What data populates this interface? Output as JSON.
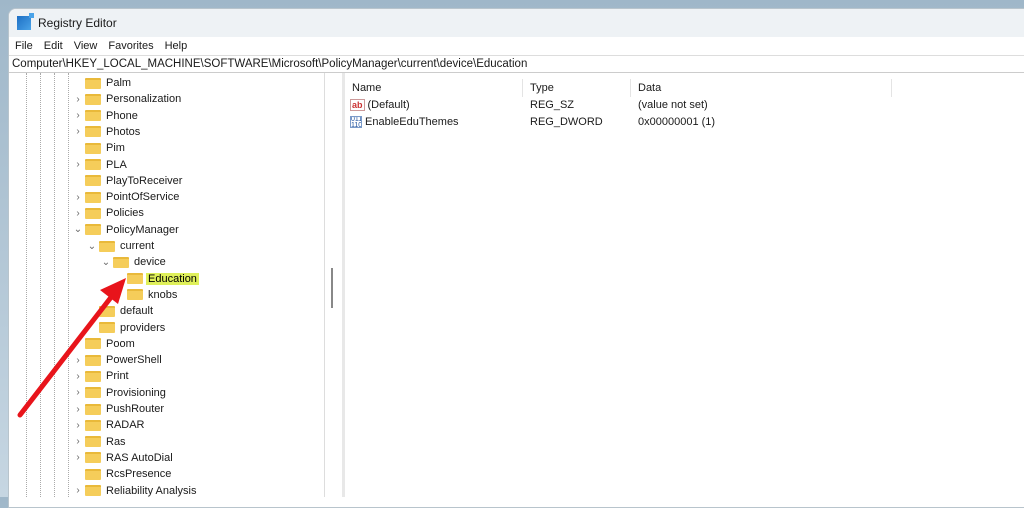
{
  "window": {
    "title": "Registry Editor"
  },
  "menu": [
    "File",
    "Edit",
    "View",
    "Favorites",
    "Help"
  ],
  "address": "Computer\\HKEY_LOCAL_MACHINE\\SOFTWARE\\Microsoft\\PolicyManager\\current\\device\\Education",
  "tree": [
    {
      "label": "Palm",
      "level": 0,
      "chevron": ""
    },
    {
      "label": "Personalization",
      "level": 0,
      "chevron": "›"
    },
    {
      "label": "Phone",
      "level": 0,
      "chevron": "›"
    },
    {
      "label": "Photos",
      "level": 0,
      "chevron": "›"
    },
    {
      "label": "Pim",
      "level": 0,
      "chevron": ""
    },
    {
      "label": "PLA",
      "level": 0,
      "chevron": "›"
    },
    {
      "label": "PlayToReceiver",
      "level": 0,
      "chevron": ""
    },
    {
      "label": "PointOfService",
      "level": 0,
      "chevron": "›"
    },
    {
      "label": "Policies",
      "level": 0,
      "chevron": "›"
    },
    {
      "label": "PolicyManager",
      "level": 0,
      "chevron": "⌄"
    },
    {
      "label": "current",
      "level": 1,
      "chevron": "⌄"
    },
    {
      "label": "device",
      "level": 2,
      "chevron": "⌄"
    },
    {
      "label": "Education",
      "level": 3,
      "chevron": "",
      "selected": true
    },
    {
      "label": "knobs",
      "level": 3,
      "chevron": ""
    },
    {
      "label": "default",
      "level": 1,
      "chevron": ""
    },
    {
      "label": "providers",
      "level": 1,
      "chevron": ""
    },
    {
      "label": "Poom",
      "level": 0,
      "chevron": ""
    },
    {
      "label": "PowerShell",
      "level": 0,
      "chevron": "›"
    },
    {
      "label": "Print",
      "level": 0,
      "chevron": "›"
    },
    {
      "label": "Provisioning",
      "level": 0,
      "chevron": "›"
    },
    {
      "label": "PushRouter",
      "level": 0,
      "chevron": "›"
    },
    {
      "label": "RADAR",
      "level": 0,
      "chevron": "›"
    },
    {
      "label": "Ras",
      "level": 0,
      "chevron": "›"
    },
    {
      "label": "RAS AutoDial",
      "level": 0,
      "chevron": "›"
    },
    {
      "label": "RcsPresence",
      "level": 0,
      "chevron": ""
    },
    {
      "label": "Reliability Analysis",
      "level": 0,
      "chevron": "›"
    }
  ],
  "columns": {
    "name": "Name",
    "type": "Type",
    "data": "Data"
  },
  "values": [
    {
      "name": "(Default)",
      "type": "REG_SZ",
      "data": "(value not set)",
      "icon": "ab"
    },
    {
      "name": "EnableEduThemes",
      "type": "REG_DWORD",
      "data": "0x00000001 (1)",
      "icon": "bin"
    }
  ],
  "annotation_color": "#e8141b"
}
